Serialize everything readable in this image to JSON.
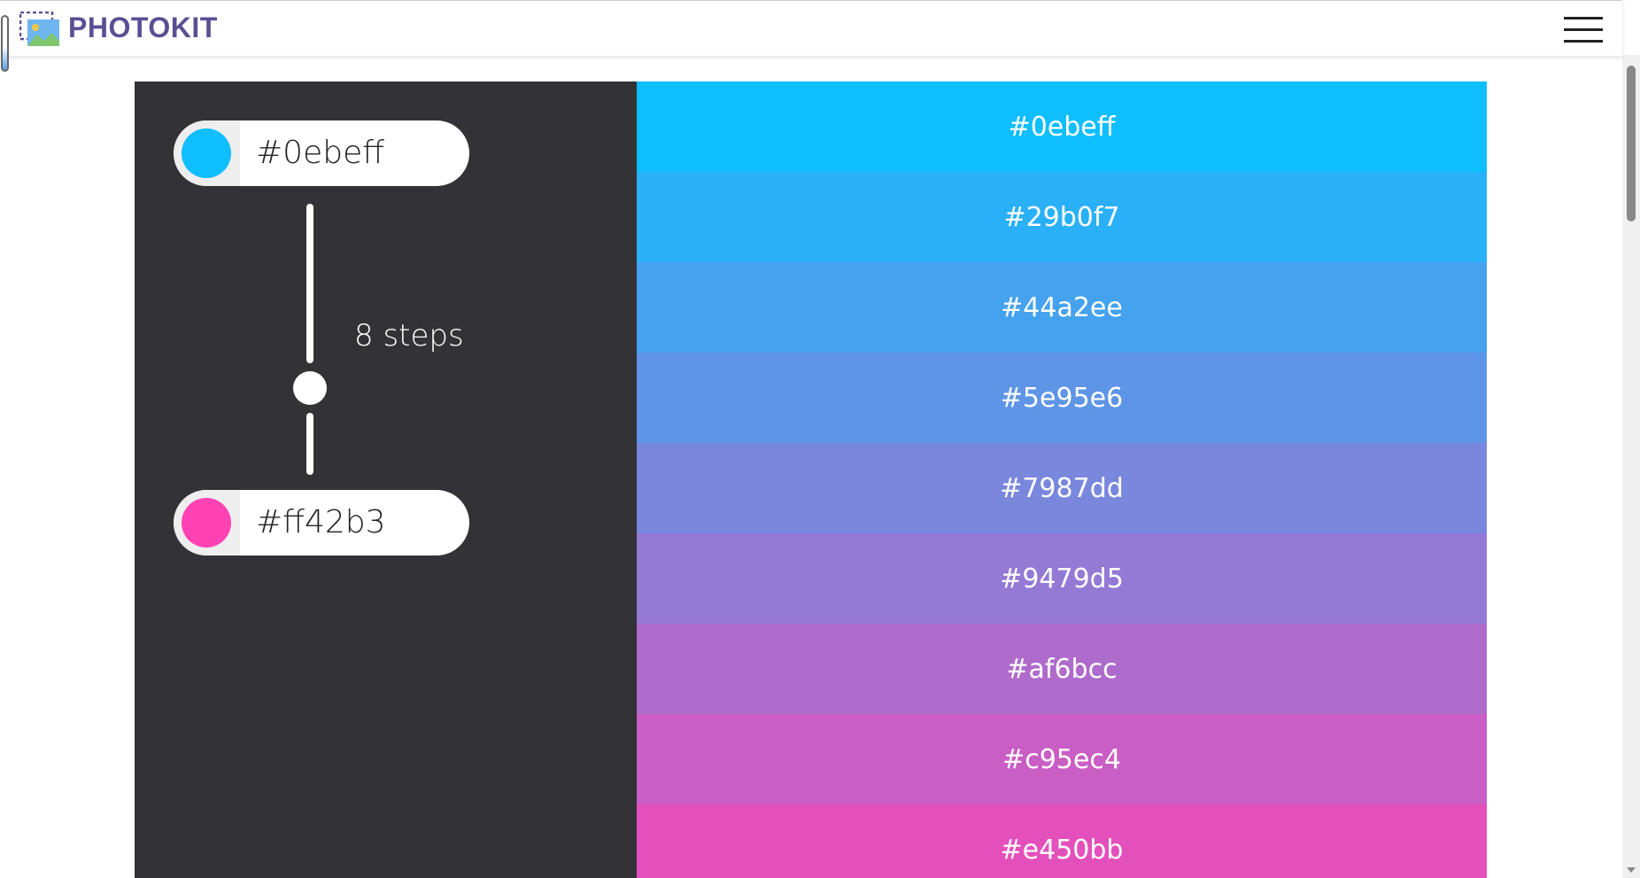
{
  "app": {
    "brand": "PHOTOKIT",
    "logo_icon": "image-gallery-icon",
    "menu_icon": "hamburger-menu-icon"
  },
  "colors": {
    "brand_text": "#5a4f93",
    "panel_bg": "#333237"
  },
  "gradient": {
    "start": {
      "value": "#0ebeff",
      "swatch": "#0ebeff"
    },
    "end": {
      "value": "#ff42b3",
      "swatch": "#ff42b3"
    },
    "steps_label": "8 steps",
    "steps": 8
  },
  "palette": [
    {
      "hex": "#0ebeff"
    },
    {
      "hex": "#29b0f7"
    },
    {
      "hex": "#44a2ee"
    },
    {
      "hex": "#5e95e6"
    },
    {
      "hex": "#7987dd"
    },
    {
      "hex": "#9479d5"
    },
    {
      "hex": "#af6bcc"
    },
    {
      "hex": "#c95ec4"
    },
    {
      "hex": "#e450bb"
    }
  ]
}
